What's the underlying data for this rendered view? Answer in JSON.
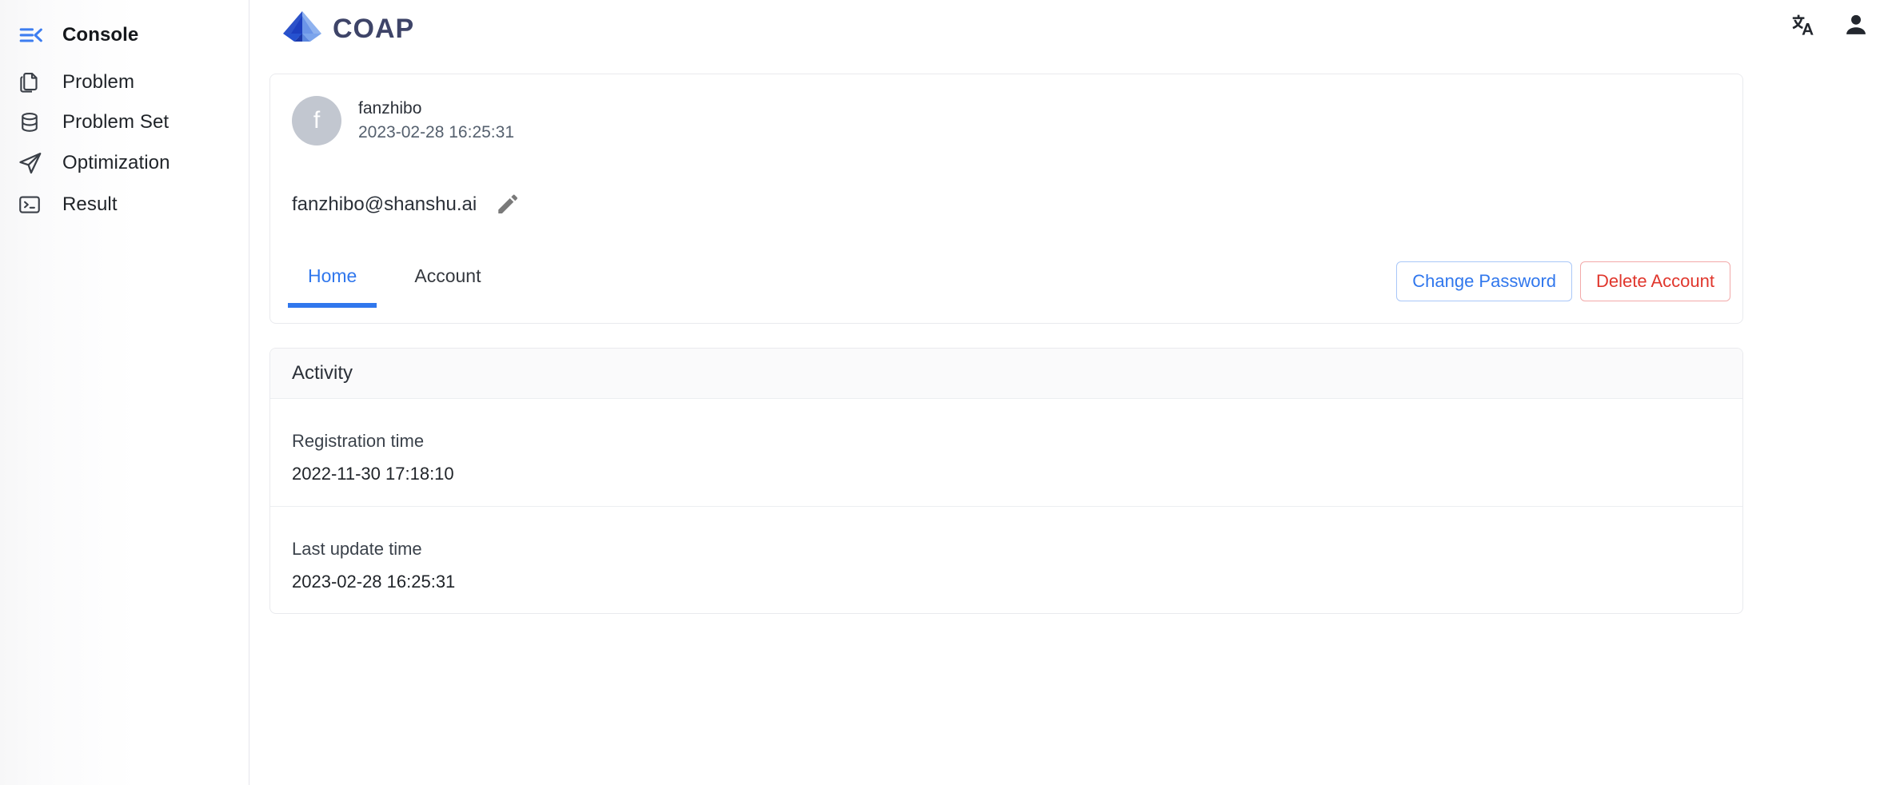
{
  "sidebar": {
    "brand": {
      "label": "Console",
      "icon": "menu-collapse-icon"
    },
    "items": [
      {
        "label": "Problem",
        "icon": "copy-document-icon"
      },
      {
        "label": "Problem Set",
        "icon": "database-icon"
      },
      {
        "label": "Optimization",
        "icon": "paper-plane-icon"
      },
      {
        "label": "Result",
        "icon": "terminal-icon"
      }
    ]
  },
  "topbar": {
    "logo_text": "COAP",
    "logo_icon": "coap-arrow-logo-icon",
    "actions": [
      {
        "name": "language-translate-icon",
        "label": "文A"
      },
      {
        "name": "user-account-icon",
        "label": ""
      }
    ]
  },
  "profile": {
    "avatar_initial": "f",
    "username": "fanzhibo",
    "updated_time": "2023-02-28 16:25:31",
    "email": "fanzhibo@shanshu.ai",
    "edit_icon": "pencil-edit-icon"
  },
  "tabs": [
    {
      "label": "Home",
      "active": true
    },
    {
      "label": "Account",
      "active": false
    }
  ],
  "tab_actions": {
    "change_password_label": "Change Password",
    "delete_account_label": "Delete Account"
  },
  "activity": {
    "title": "Activity",
    "rows": [
      {
        "label": "Registration time",
        "value": "2022-11-30 17:18:10"
      },
      {
        "label": "Last update time",
        "value": "2023-02-28 16:25:31"
      }
    ]
  },
  "colors": {
    "accent_blue": "#3077ed",
    "danger_red": "#e0362c",
    "avatar_grey": "#c2c7d0",
    "text_dark": "#1f2328",
    "border": "#e9eaee"
  }
}
